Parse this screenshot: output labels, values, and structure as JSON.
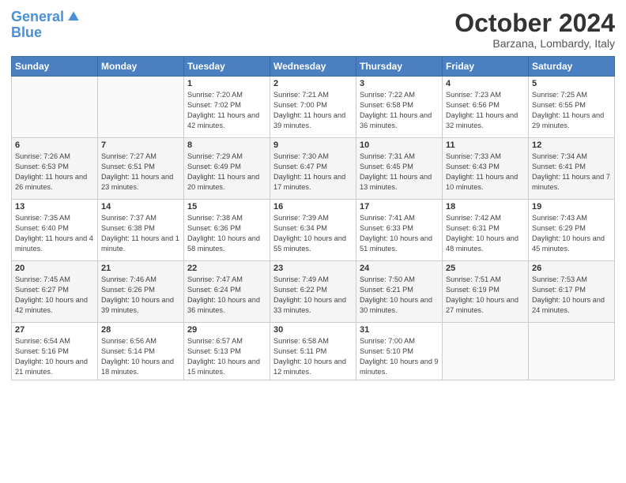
{
  "header": {
    "logo_line1": "General",
    "logo_line2": "Blue",
    "month": "October 2024",
    "location": "Barzana, Lombardy, Italy"
  },
  "days_of_week": [
    "Sunday",
    "Monday",
    "Tuesday",
    "Wednesday",
    "Thursday",
    "Friday",
    "Saturday"
  ],
  "weeks": [
    [
      {
        "day": "",
        "info": ""
      },
      {
        "day": "",
        "info": ""
      },
      {
        "day": "1",
        "info": "Sunrise: 7:20 AM\nSunset: 7:02 PM\nDaylight: 11 hours and 42 minutes."
      },
      {
        "day": "2",
        "info": "Sunrise: 7:21 AM\nSunset: 7:00 PM\nDaylight: 11 hours and 39 minutes."
      },
      {
        "day": "3",
        "info": "Sunrise: 7:22 AM\nSunset: 6:58 PM\nDaylight: 11 hours and 36 minutes."
      },
      {
        "day": "4",
        "info": "Sunrise: 7:23 AM\nSunset: 6:56 PM\nDaylight: 11 hours and 32 minutes."
      },
      {
        "day": "5",
        "info": "Sunrise: 7:25 AM\nSunset: 6:55 PM\nDaylight: 11 hours and 29 minutes."
      }
    ],
    [
      {
        "day": "6",
        "info": "Sunrise: 7:26 AM\nSunset: 6:53 PM\nDaylight: 11 hours and 26 minutes."
      },
      {
        "day": "7",
        "info": "Sunrise: 7:27 AM\nSunset: 6:51 PM\nDaylight: 11 hours and 23 minutes."
      },
      {
        "day": "8",
        "info": "Sunrise: 7:29 AM\nSunset: 6:49 PM\nDaylight: 11 hours and 20 minutes."
      },
      {
        "day": "9",
        "info": "Sunrise: 7:30 AM\nSunset: 6:47 PM\nDaylight: 11 hours and 17 minutes."
      },
      {
        "day": "10",
        "info": "Sunrise: 7:31 AM\nSunset: 6:45 PM\nDaylight: 11 hours and 13 minutes."
      },
      {
        "day": "11",
        "info": "Sunrise: 7:33 AM\nSunset: 6:43 PM\nDaylight: 11 hours and 10 minutes."
      },
      {
        "day": "12",
        "info": "Sunrise: 7:34 AM\nSunset: 6:41 PM\nDaylight: 11 hours and 7 minutes."
      }
    ],
    [
      {
        "day": "13",
        "info": "Sunrise: 7:35 AM\nSunset: 6:40 PM\nDaylight: 11 hours and 4 minutes."
      },
      {
        "day": "14",
        "info": "Sunrise: 7:37 AM\nSunset: 6:38 PM\nDaylight: 11 hours and 1 minute."
      },
      {
        "day": "15",
        "info": "Sunrise: 7:38 AM\nSunset: 6:36 PM\nDaylight: 10 hours and 58 minutes."
      },
      {
        "day": "16",
        "info": "Sunrise: 7:39 AM\nSunset: 6:34 PM\nDaylight: 10 hours and 55 minutes."
      },
      {
        "day": "17",
        "info": "Sunrise: 7:41 AM\nSunset: 6:33 PM\nDaylight: 10 hours and 51 minutes."
      },
      {
        "day": "18",
        "info": "Sunrise: 7:42 AM\nSunset: 6:31 PM\nDaylight: 10 hours and 48 minutes."
      },
      {
        "day": "19",
        "info": "Sunrise: 7:43 AM\nSunset: 6:29 PM\nDaylight: 10 hours and 45 minutes."
      }
    ],
    [
      {
        "day": "20",
        "info": "Sunrise: 7:45 AM\nSunset: 6:27 PM\nDaylight: 10 hours and 42 minutes."
      },
      {
        "day": "21",
        "info": "Sunrise: 7:46 AM\nSunset: 6:26 PM\nDaylight: 10 hours and 39 minutes."
      },
      {
        "day": "22",
        "info": "Sunrise: 7:47 AM\nSunset: 6:24 PM\nDaylight: 10 hours and 36 minutes."
      },
      {
        "day": "23",
        "info": "Sunrise: 7:49 AM\nSunset: 6:22 PM\nDaylight: 10 hours and 33 minutes."
      },
      {
        "day": "24",
        "info": "Sunrise: 7:50 AM\nSunset: 6:21 PM\nDaylight: 10 hours and 30 minutes."
      },
      {
        "day": "25",
        "info": "Sunrise: 7:51 AM\nSunset: 6:19 PM\nDaylight: 10 hours and 27 minutes."
      },
      {
        "day": "26",
        "info": "Sunrise: 7:53 AM\nSunset: 6:17 PM\nDaylight: 10 hours and 24 minutes."
      }
    ],
    [
      {
        "day": "27",
        "info": "Sunrise: 6:54 AM\nSunset: 5:16 PM\nDaylight: 10 hours and 21 minutes."
      },
      {
        "day": "28",
        "info": "Sunrise: 6:56 AM\nSunset: 5:14 PM\nDaylight: 10 hours and 18 minutes."
      },
      {
        "day": "29",
        "info": "Sunrise: 6:57 AM\nSunset: 5:13 PM\nDaylight: 10 hours and 15 minutes."
      },
      {
        "day": "30",
        "info": "Sunrise: 6:58 AM\nSunset: 5:11 PM\nDaylight: 10 hours and 12 minutes."
      },
      {
        "day": "31",
        "info": "Sunrise: 7:00 AM\nSunset: 5:10 PM\nDaylight: 10 hours and 9 minutes."
      },
      {
        "day": "",
        "info": ""
      },
      {
        "day": "",
        "info": ""
      }
    ]
  ]
}
